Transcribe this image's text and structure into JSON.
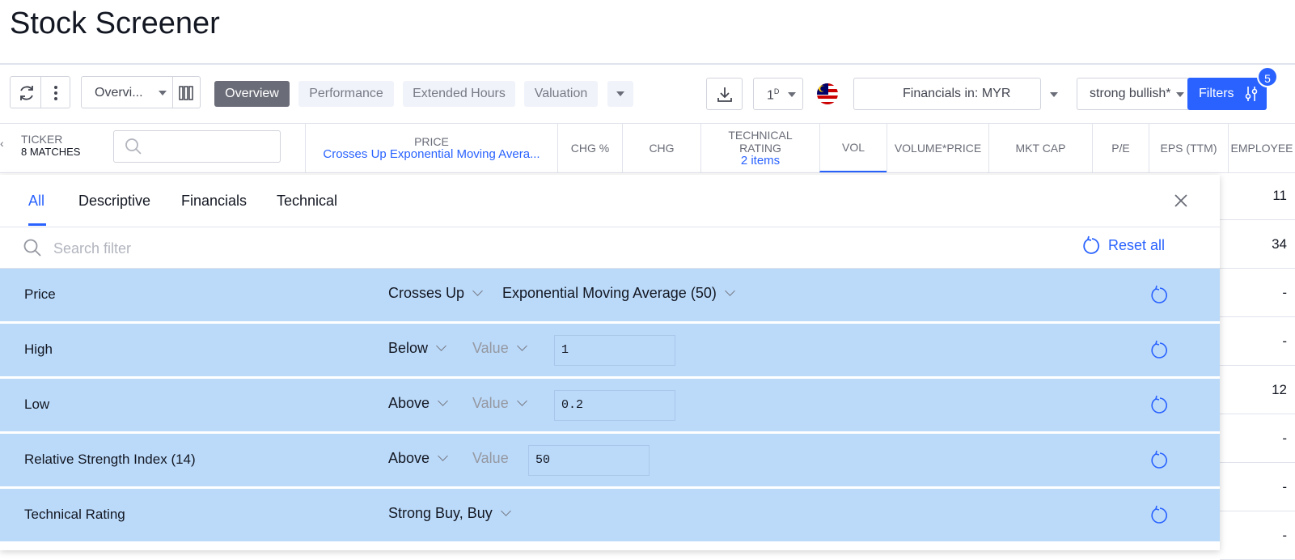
{
  "page": {
    "title": "Stock Screener"
  },
  "toolbar": {
    "columns_select": "Overvi...",
    "tabs": [
      "Overview",
      "Performance",
      "Extended Hours",
      "Valuation"
    ],
    "interval": "1",
    "interval_sup": "D",
    "financials": "Financials in: MYR",
    "preset": "strong bullish*",
    "filters_label": "Filters",
    "filters_count": "5"
  },
  "columns": {
    "ticker": "TICKER",
    "ticker_matches": "8 MATCHES",
    "price": "PRICE",
    "price_sub": "Crosses Up Exponential Moving Avera...",
    "chg_pct": "CHG %",
    "chg": "CHG",
    "tech_rating_1": "TECHNICAL",
    "tech_rating_2": "RATING",
    "tech_rating_sub": "2 items",
    "vol": "VOL",
    "volume_price": "VOLUME*PRICE",
    "mkt_cap": "MKT CAP",
    "pe": "P/E",
    "eps": "EPS (TTM)",
    "employees": "EMPLOYEE"
  },
  "peek_values": [
    "11",
    "34",
    "-",
    "-",
    "12",
    "-",
    "-",
    "-"
  ],
  "filter_panel": {
    "tabs": [
      "All",
      "Descriptive",
      "Financials",
      "Technical"
    ],
    "search_placeholder": "Search filter",
    "reset_all": "Reset all",
    "rows": [
      {
        "label": "Price",
        "operator": "Crosses Up",
        "target": "Exponential Moving Average (50)"
      },
      {
        "label": "High",
        "operator": "Below",
        "value_label": "Value",
        "value": "1"
      },
      {
        "label": "Low",
        "operator": "Above",
        "value_label": "Value",
        "value": "0.2"
      },
      {
        "label": "Relative Strength Index (14)",
        "operator": "Above",
        "value_label": "Value",
        "value": "50"
      },
      {
        "label": "Technical Rating",
        "operator": "Strong Buy, Buy"
      }
    ]
  },
  "colors": {
    "accent": "#2962ff",
    "filter_row_bg": "#bbdafa",
    "active_tab_bg": "#6a6d78"
  }
}
